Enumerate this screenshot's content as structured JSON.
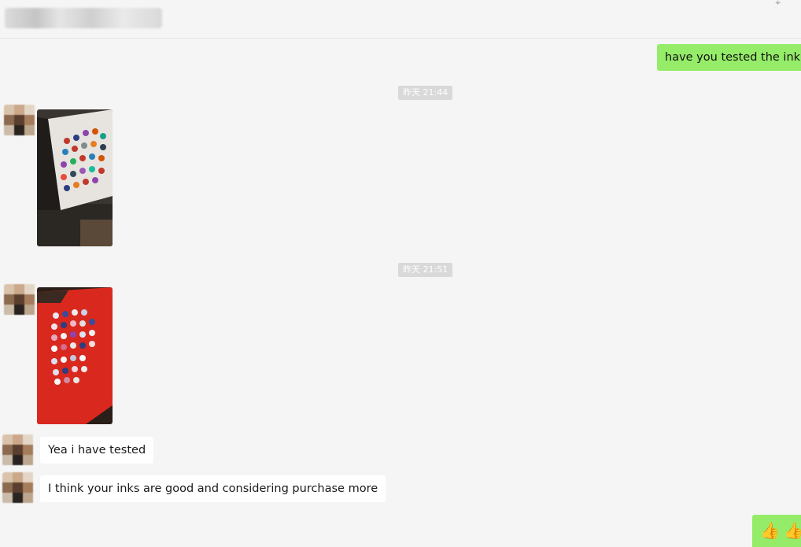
{
  "header": {
    "more_icon": "pin-icon",
    "more_glyph": "⌖"
  },
  "messages": {
    "m1": {
      "text": "have you tested the ink ?>"
    },
    "t1": {
      "text": "昨天 21:44"
    },
    "t2": {
      "text": "昨天 21:51"
    },
    "m4": {
      "text": "Yea i have tested"
    },
    "m5": {
      "text": "I think your inks are good and considering purchase more"
    },
    "m6": {
      "emoji": [
        "👍",
        "👍"
      ]
    }
  },
  "colors": {
    "background": "#f5f5f5",
    "my_bubble": "#95ec69",
    "their_bubble": "#ffffff",
    "time_tag": "#d9d9d9"
  }
}
